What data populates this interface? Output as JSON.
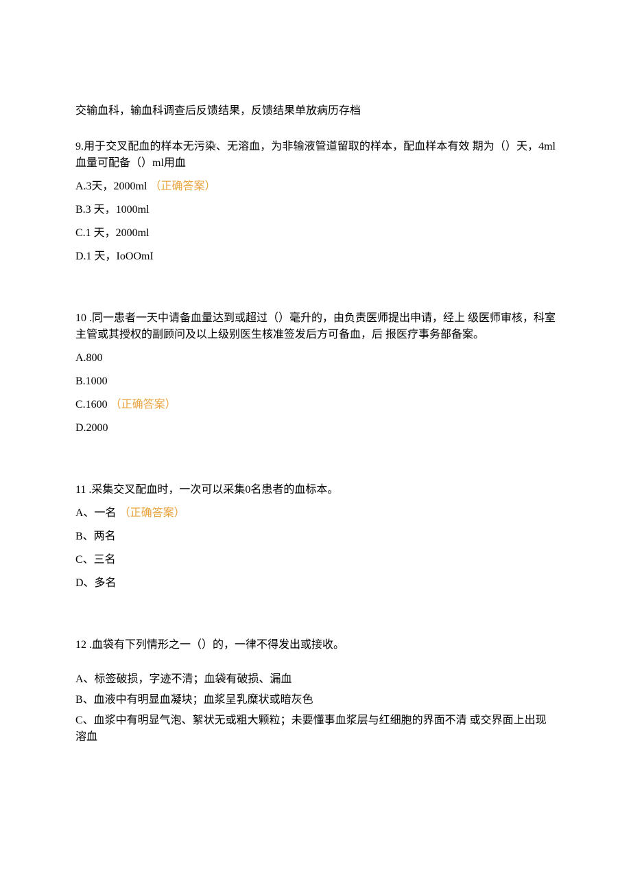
{
  "intro_line": "交输血科，输血科调查后反馈结果，反馈结果单放病历存档",
  "q9": {
    "stem": "9.用于交叉配血的样本无污染、无溶血，为非输液管道留取的样本，配血样本有效 期为（）天，4ml血量可配备（）ml用血",
    "a": "A.3天，2000ml",
    "a_correct": "（正确答案）",
    "b": "B.3 天，1000ml",
    "c": "C.1 天，2000ml",
    "d": "D.1 天，IoOOmI"
  },
  "q10": {
    "stem": "10 .同一患者一天中请备血量达到或超过（）毫升的，由负责医师提出申请，经上 级医师审核，科室主管或其授权的副顾问及以上级别医生核准签发后方可备血，后 报医疗事务部备案。",
    "a": "A.800",
    "b": "B.1000",
    "c": "C.1600",
    "c_correct": "（正确答案）",
    "d": "D.2000"
  },
  "q11": {
    "stem": "11 .采集交叉配血时，一次可以采集0名患者的血标本。",
    "a": "A、一名",
    "a_correct": "（正确答案）",
    "b": "B、两名",
    "c": "C、三名",
    "d": "D、多名"
  },
  "q12": {
    "stem": "12 .血袋有下列情形之一（）的，一律不得发出或接收。",
    "a": "A、标签破损，字迹不清；血袋有破损、漏血",
    "b": "B、血液中有明显血凝块；血浆呈乳糜状或暗灰色",
    "c": "C、血浆中有明显气泡、絮状无或粗大颗粒；未要懂事血浆层与红细胞的界面不清 或交界面上出现溶血"
  }
}
